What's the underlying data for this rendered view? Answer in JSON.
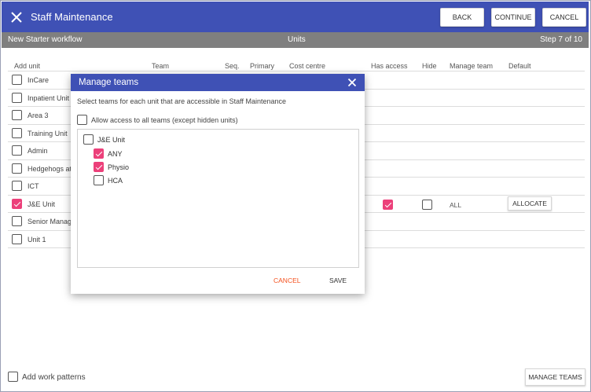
{
  "header": {
    "title": "Staff Maintenance",
    "back_label": "BACK",
    "continue_label": "CONTINUE",
    "cancel_label": "CANCEL",
    "color": "#3f51b5"
  },
  "subbar": {
    "workflow": "New Starter workflow",
    "section": "Units",
    "step": "Step 7 of 10"
  },
  "table": {
    "columns": [
      "Add unit",
      "Team",
      "Seq.",
      "Primary",
      "Cost centre",
      "Has access",
      "Hide",
      "Manage team",
      "Default"
    ],
    "rows": [
      {
        "label": "InCare",
        "checked": false
      },
      {
        "label": "Inpatient Unit",
        "checked": false
      },
      {
        "label": "Area 3",
        "checked": false
      },
      {
        "label": "Training Unit",
        "checked": false
      },
      {
        "label": "Admin",
        "checked": false
      },
      {
        "label": "Hedgehogs at",
        "checked": false
      },
      {
        "label": "ICT",
        "checked": false
      },
      {
        "label": "J&E Unit",
        "checked": true
      },
      {
        "label": "Senior Manag",
        "checked": false
      },
      {
        "label": "Unit 1",
        "checked": false
      }
    ],
    "selected_row": {
      "has_access": true,
      "hide": false,
      "manage_team": "ALL",
      "allocate_label": "ALLOCATE"
    }
  },
  "dialog": {
    "title": "Manage teams",
    "description": "Select teams for each unit that are accessible in Staff Maintenance",
    "allow_all_label": "Allow access to all teams (except hidden units)",
    "allow_all_checked": false,
    "tree": [
      {
        "label": "J&E Unit",
        "checked": false,
        "level": 0
      },
      {
        "label": "ANY",
        "checked": true,
        "level": 1
      },
      {
        "label": "Physio",
        "checked": true,
        "level": 1
      },
      {
        "label": "HCA",
        "checked": false,
        "level": 1
      }
    ],
    "cancel_label": "CANCEL",
    "save_label": "SAVE",
    "cancel_color": "#f4511e"
  },
  "footer": {
    "work_patterns_label": "Add work patterns",
    "work_patterns_checked": false,
    "manage_teams_label": "MANAGE TEAMS"
  },
  "accent_color": "#ec407a"
}
